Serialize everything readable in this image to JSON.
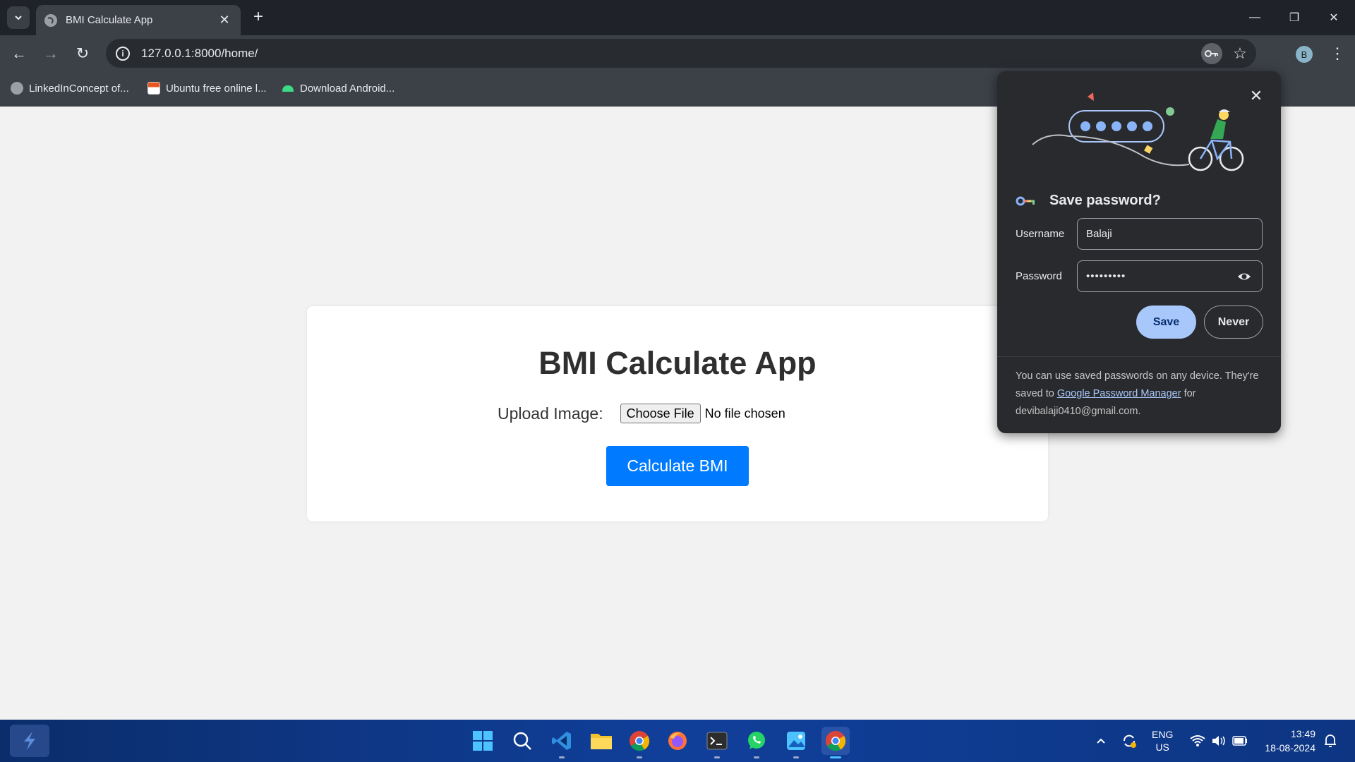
{
  "browser": {
    "tab_title": "BMI Calculate App",
    "url": "127.0.0.1:8000/home/",
    "profile_initial": "B",
    "bookmarks": [
      {
        "label": "LinkedInConcept of..."
      },
      {
        "label": "Ubuntu free online l..."
      },
      {
        "label": "Download Android..."
      }
    ]
  },
  "page": {
    "title": "BMI Calculate App",
    "upload_label": "Upload Image:",
    "choose_file_label": "Choose File",
    "no_file_text": "No file chosen",
    "calculate_label": "Calculate BMI",
    "accent_color": "#007bff"
  },
  "password_popup": {
    "title": "Save password?",
    "username_label": "Username",
    "username_value": "Balaji",
    "password_label": "Password",
    "password_mask": "•••••••••",
    "save_label": "Save",
    "never_label": "Never",
    "footer_prefix": "You can use saved passwords on any device. They're saved to ",
    "footer_link": "Google Password Manager",
    "footer_suffix": " for devibalaji0410@gmail.com."
  },
  "taskbar": {
    "apps": [
      "start-icon",
      "search-icon",
      "vscode-icon",
      "file-explorer-icon",
      "chrome-icon",
      "firefox-icon",
      "terminal-icon",
      "whatsapp-icon",
      "photos-icon",
      "chrome-active-icon"
    ],
    "language_top": "ENG",
    "language_bottom": "US",
    "time": "13:49",
    "date": "18-08-2024"
  }
}
